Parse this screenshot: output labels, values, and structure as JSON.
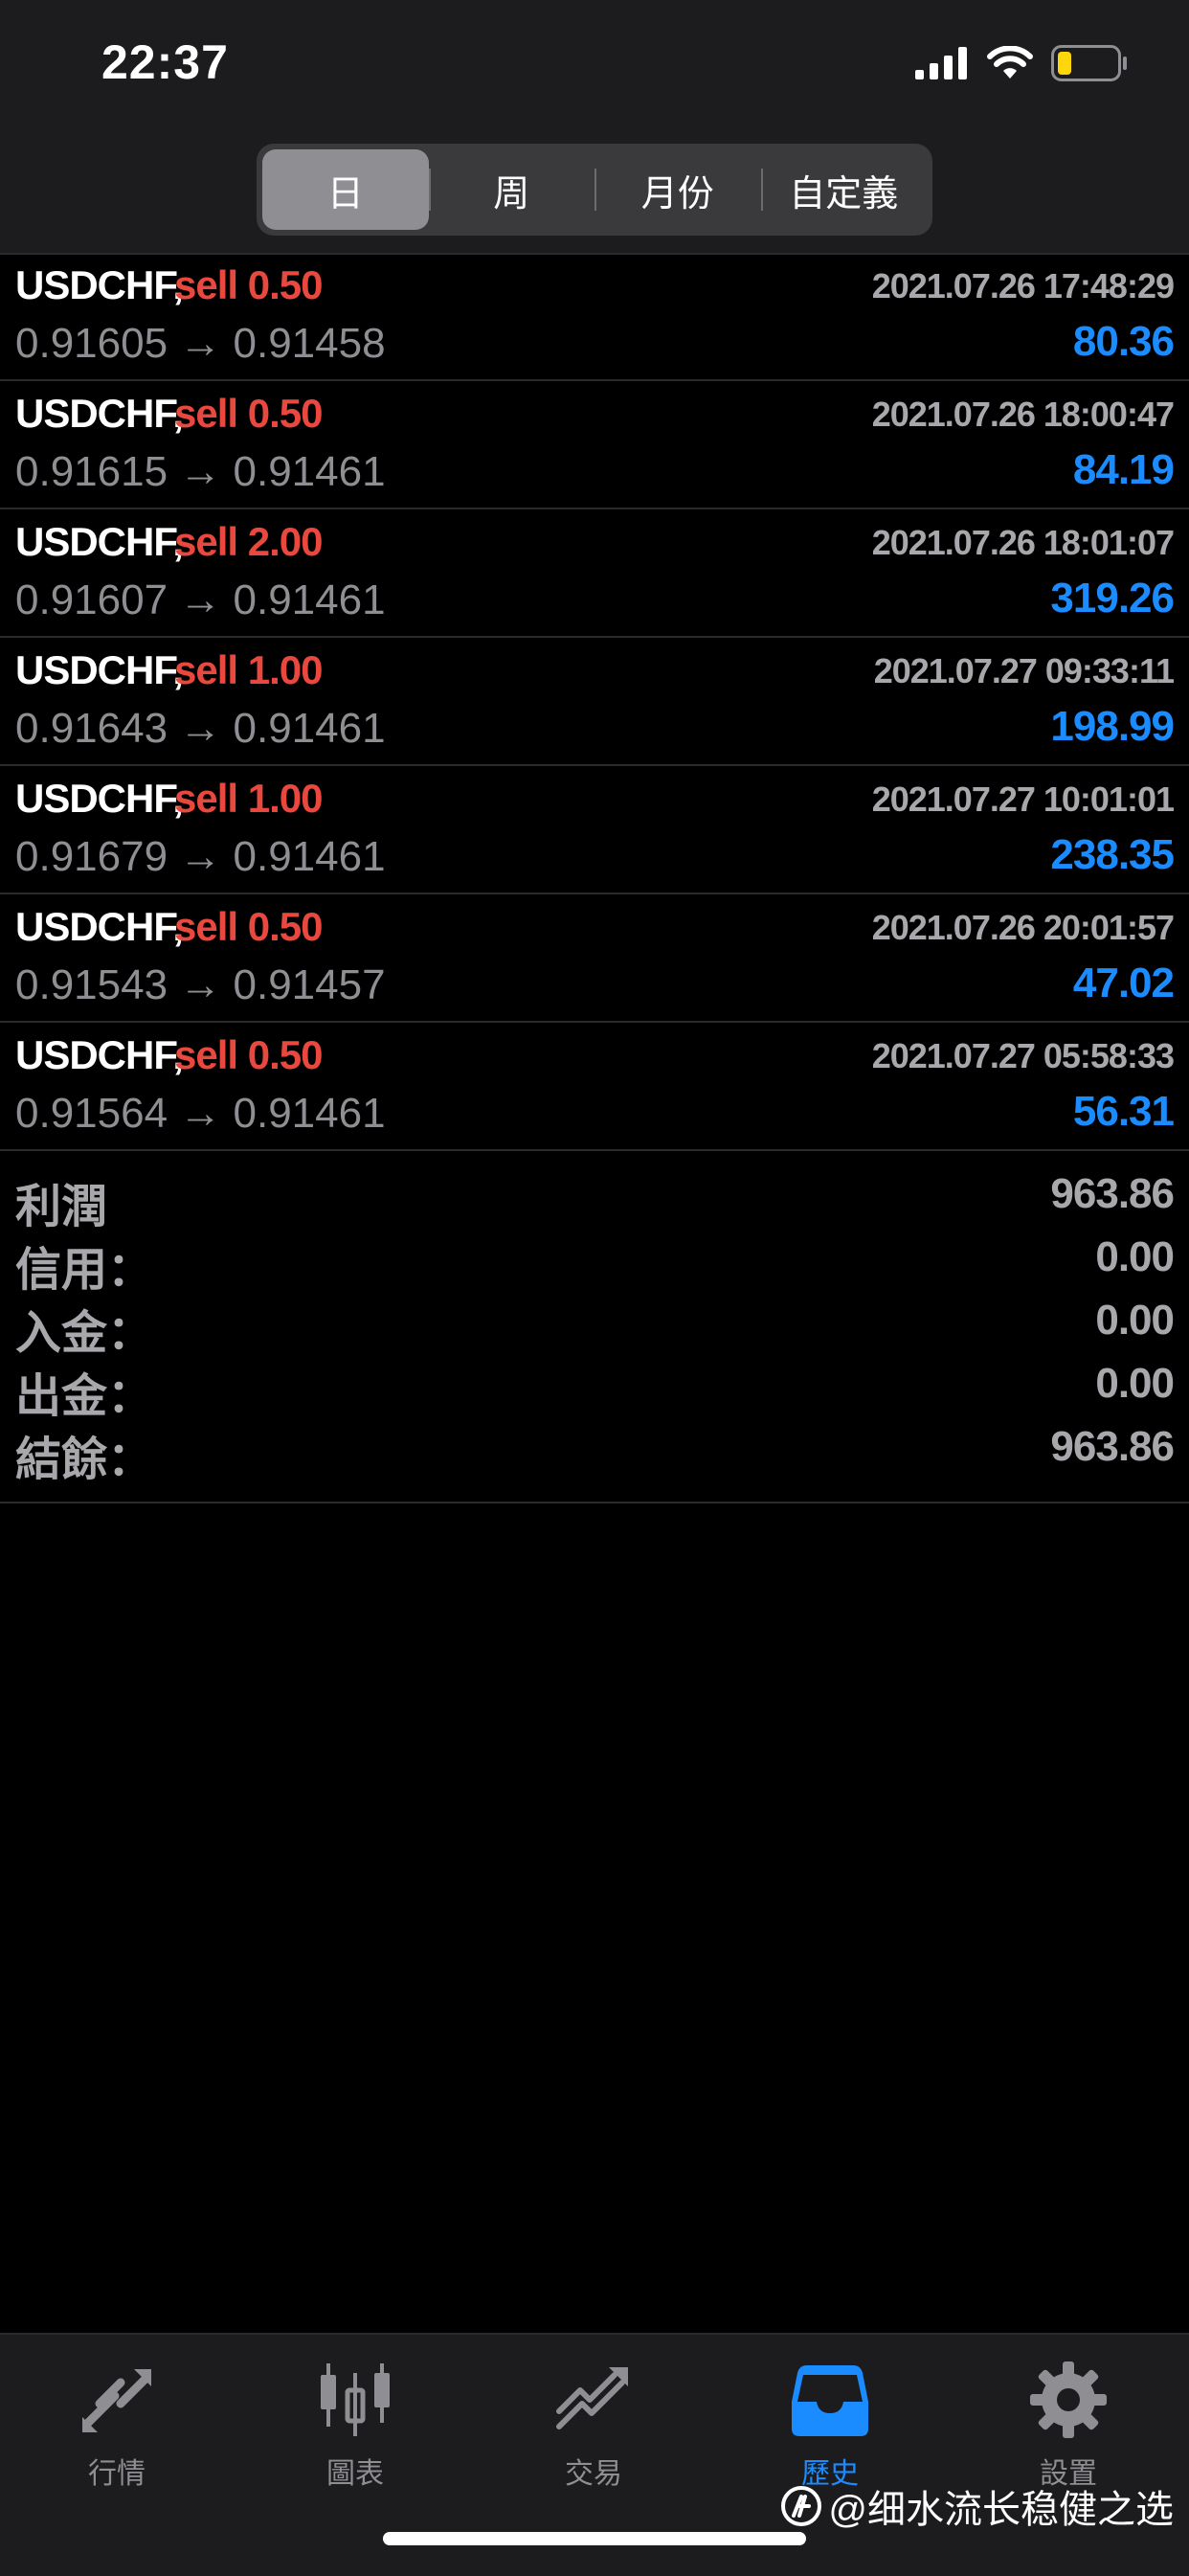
{
  "status_bar": {
    "time": "22:37"
  },
  "segmented": {
    "tabs": [
      {
        "label": "日",
        "active": true
      },
      {
        "label": "周",
        "active": false
      },
      {
        "label": "月份",
        "active": false
      },
      {
        "label": "自定義",
        "active": false
      }
    ]
  },
  "trades": [
    {
      "symbol": "USDCHF,",
      "side": "sell 0.50",
      "time": "2021.07.26 17:48:29",
      "prices": "0.91605 → 0.91458",
      "profit": "80.36"
    },
    {
      "symbol": "USDCHF,",
      "side": "sell 0.50",
      "time": "2021.07.26 18:00:47",
      "prices": "0.91615 → 0.91461",
      "profit": "84.19"
    },
    {
      "symbol": "USDCHF,",
      "side": "sell 2.00",
      "time": "2021.07.26 18:01:07",
      "prices": "0.91607 → 0.91461",
      "profit": "319.26"
    },
    {
      "symbol": "USDCHF,",
      "side": "sell 1.00",
      "time": "2021.07.27 09:33:11",
      "prices": "0.91643 → 0.91461",
      "profit": "198.99"
    },
    {
      "symbol": "USDCHF,",
      "side": "sell 1.00",
      "time": "2021.07.27 10:01:01",
      "prices": "0.91679 → 0.91461",
      "profit": "238.35"
    },
    {
      "symbol": "USDCHF,",
      "side": "sell 0.50",
      "time": "2021.07.26 20:01:57",
      "prices": "0.91543 → 0.91457",
      "profit": "47.02"
    },
    {
      "symbol": "USDCHF,",
      "side": "sell 0.50",
      "time": "2021.07.27 05:58:33",
      "prices": "0.91564 → 0.91461",
      "profit": "56.31"
    }
  ],
  "summary": [
    {
      "label": "利潤",
      "value": "963.86"
    },
    {
      "label": "信用：",
      "value": "0.00"
    },
    {
      "label": "入金：",
      "value": "0.00"
    },
    {
      "label": "出金：",
      "value": "0.00"
    },
    {
      "label": "結餘：",
      "value": "963.86"
    }
  ],
  "tab_bar": {
    "tabs": [
      {
        "label": "行情",
        "icon": "quotes-arrows-icon",
        "active": false
      },
      {
        "label": "圖表",
        "icon": "candlestick-chart-icon",
        "active": false
      },
      {
        "label": "交易",
        "icon": "trade-line-icon",
        "active": false
      },
      {
        "label": "歷史",
        "icon": "history-inbox-icon",
        "active": true
      },
      {
        "label": "設置",
        "icon": "settings-gear-icon",
        "active": false
      }
    ]
  },
  "watermark": {
    "text": "@细水流长稳健之选"
  },
  "colors": {
    "sell": "#e8483d",
    "profit": "#1a8cff",
    "active_tab": "#1a8cff",
    "inactive": "#8e8e93"
  }
}
